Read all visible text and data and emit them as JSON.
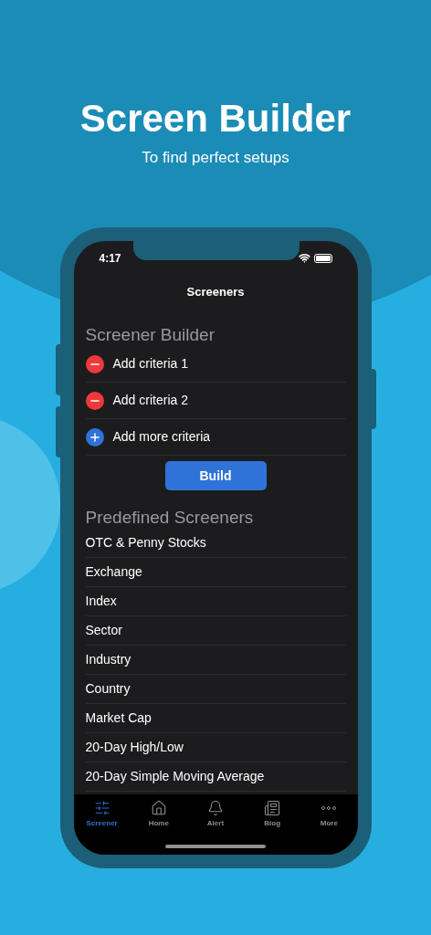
{
  "hero": {
    "title": "Screen Builder",
    "subtitle": "To find perfect setups"
  },
  "status_bar": {
    "time": "4:17"
  },
  "nav": {
    "title": "Screeners"
  },
  "builder": {
    "header": "Screener Builder",
    "criteria": [
      {
        "kind": "remove",
        "label": "Add criteria 1"
      },
      {
        "kind": "remove",
        "label": "Add criteria 2"
      },
      {
        "kind": "add",
        "label": "Add more criteria"
      }
    ],
    "button": "Build"
  },
  "predefined": {
    "header": "Predefined Screeners",
    "items": [
      "OTC & Penny Stocks",
      "Exchange",
      "Index",
      "Sector",
      "Industry",
      "Country",
      "Market Cap",
      "20-Day High/Low",
      "20-Day Simple Moving Average"
    ]
  },
  "tab_bar": [
    {
      "kind": "screener",
      "label": "Screener",
      "selected": true
    },
    {
      "kind": "home",
      "label": "Home",
      "selected": false
    },
    {
      "kind": "alert",
      "label": "Alert",
      "selected": false
    },
    {
      "kind": "blog",
      "label": "Blog",
      "selected": false
    },
    {
      "kind": "more",
      "label": "More",
      "selected": false
    }
  ]
}
